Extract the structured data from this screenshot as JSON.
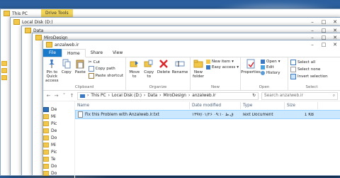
{
  "windows": [
    {
      "title": "This PC",
      "tag": "Drive Tools"
    },
    {
      "title": "Local Disk (D:)"
    },
    {
      "title": "Data"
    },
    {
      "title": "MiroDesign"
    },
    {
      "title": "anzalweb.ir"
    }
  ],
  "ribbon": {
    "tabs": [
      "File",
      "Home",
      "Share",
      "View"
    ],
    "clipboard": {
      "pin": "Pin to Quick access",
      "copy": "Copy",
      "paste": "Paste",
      "cut": "Cut",
      "copy_path": "Copy path",
      "paste_shortcut": "Paste shortcut",
      "group": "Clipboard"
    },
    "organize": {
      "move_to": "Move to",
      "copy_to": "Copy to",
      "delete": "Delete",
      "rename": "Rename",
      "group": "Organize"
    },
    "new": {
      "new_folder": "New folder",
      "new_item": "New item",
      "easy_access": "Easy access",
      "group": "New"
    },
    "open": {
      "properties": "Properties",
      "open": "Open",
      "edit": "Edit",
      "history": "History",
      "group": "Open"
    },
    "select": {
      "select_all": "Select all",
      "select_none": "Select none",
      "invert": "Invert selection",
      "group": "Select"
    }
  },
  "address": {
    "path": [
      "This PC",
      "Local Disk (D:)",
      "Data",
      "MiroDesign",
      "anzalweb.ir"
    ],
    "search_placeholder": "Search anzalweb.ir"
  },
  "columns": [
    "Name",
    "Date modified",
    "Type",
    "Size"
  ],
  "files": [
    {
      "name": "Fix this Problem with Anzalweb.ir.txt",
      "date": "۱۳۹۷/۰۱/۲۶ ق.ظ ۰۹:۱۰",
      "type": "Text Document",
      "size": "1 KB"
    }
  ],
  "nav_items": [
    "De",
    "Mi",
    "Pic",
    "De",
    "Do",
    "Mi",
    "Pic",
    "Te",
    "Do",
    "Do",
    "Do"
  ]
}
